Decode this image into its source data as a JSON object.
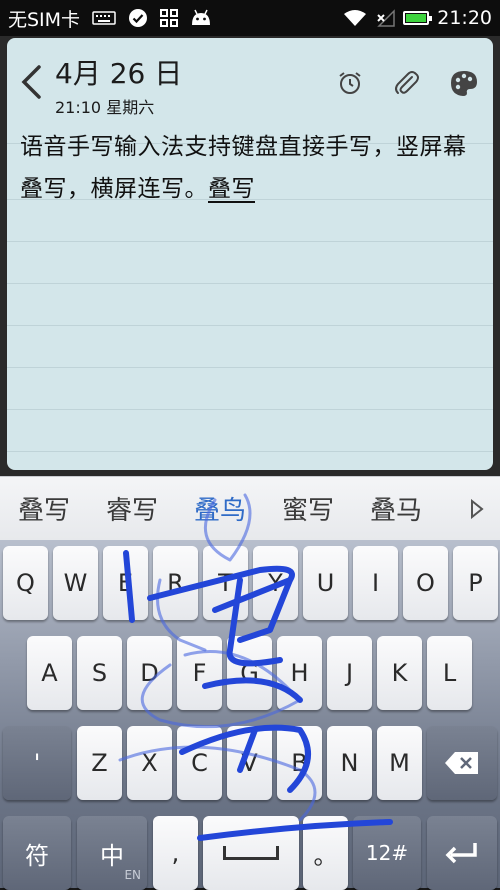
{
  "status_bar": {
    "carrier": "无SIM卡",
    "time": "21:20",
    "icons": [
      "keyboard-icon",
      "check-circle-icon",
      "apps-grid-icon",
      "android-icon",
      "wifi-icon",
      "no-signal-icon",
      "battery-icon"
    ],
    "battery_color": "#3ed33e"
  },
  "note": {
    "date": "4月 26 日",
    "subtitle": "21:10 星期六",
    "text_main": "语音手写输入法支持键盘直接手写，竖屏幕叠写，横屏连写。",
    "text_composing": "叠写",
    "background_color": "#d3e6ea",
    "header_icons": [
      "alarm-icon",
      "attachment-icon",
      "palette-icon"
    ]
  },
  "candidates": {
    "items": [
      "叠写",
      "睿写",
      "叠鸟",
      "蜜写",
      "叠马"
    ],
    "active_index": 2,
    "more_icon": "triangle-right-icon",
    "active_color": "#2f6bc7"
  },
  "keyboard": {
    "row1": [
      "Q",
      "W",
      "E",
      "R",
      "T",
      "Y",
      "U",
      "I",
      "O",
      "P"
    ],
    "row2": [
      "A",
      "S",
      "D",
      "F",
      "G",
      "H",
      "J",
      "K",
      "L"
    ],
    "row3_left": "'",
    "row3": [
      "Z",
      "X",
      "C",
      "V",
      "B",
      "N",
      "M"
    ],
    "bottom": {
      "symbol": "符",
      "lang": "中",
      "lang_sub": "EN",
      "comma": ",",
      "period": "。",
      "numbers": "12#"
    },
    "ink_color": "#2346d8"
  }
}
